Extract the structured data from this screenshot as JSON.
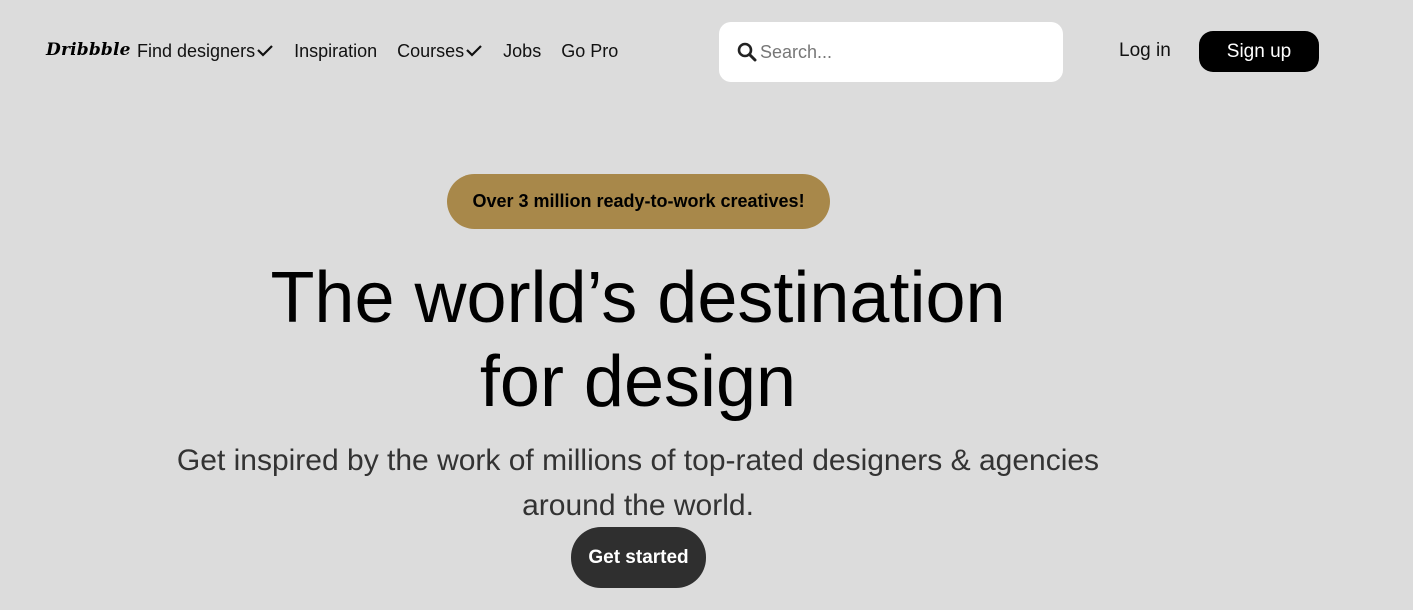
{
  "nav": {
    "logo_text": "Dribbble",
    "links": [
      {
        "label": "Find designers",
        "has_dropdown": true
      },
      {
        "label": "Inspiration",
        "has_dropdown": false
      },
      {
        "label": "Courses",
        "has_dropdown": true
      },
      {
        "label": "Jobs",
        "has_dropdown": false
      },
      {
        "label": "Go Pro",
        "has_dropdown": false
      }
    ],
    "search": {
      "placeholder": "Search...",
      "value": "",
      "icon": "search-icon"
    },
    "login_label": "Log in",
    "signup_label": "Sign up"
  },
  "hero": {
    "badge": "Over 3 million ready-to-work creatives!",
    "headline_line1": "The world’s destination",
    "headline_line2": "for design",
    "subheadline_line1": "Get inspired by the work of millions of top-rated designers & agencies",
    "subheadline_line2": "around the world.",
    "cta_label": "Get started"
  },
  "colors": {
    "background": "#dcdcdc",
    "badge_bg": "#a8884a",
    "signup_bg": "#000000",
    "cta_bg": "#2f2f2f"
  }
}
